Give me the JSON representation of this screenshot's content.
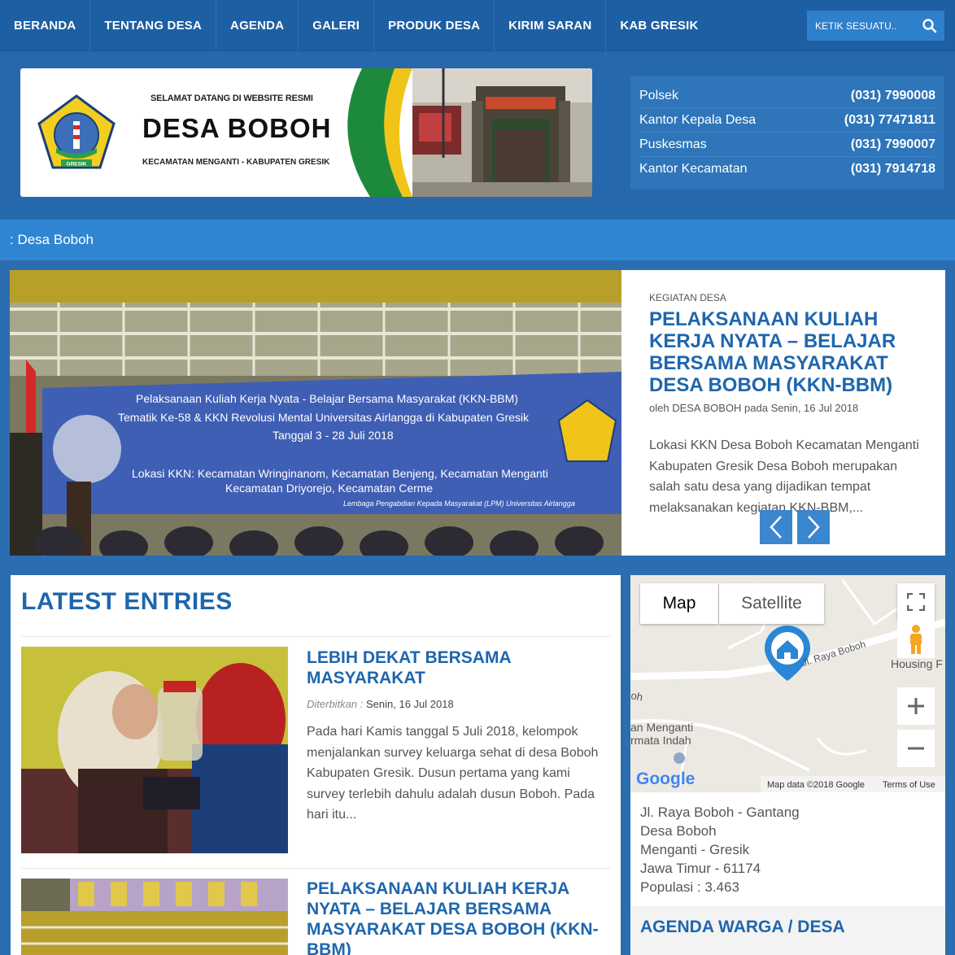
{
  "nav": {
    "items": [
      "BERANDA",
      "TENTANG DESA",
      "AGENDA",
      "GALERI",
      "PRODUK DESA",
      "KIRIM SARAN",
      "KAB GRESIK"
    ],
    "search_placeholder": "KETIK SESUATU.."
  },
  "banner": {
    "welcome": "SELAMAT DATANG DI WEBSITE RESMI",
    "name": "DESA BOBOH",
    "sub": "KECAMATAN MENGANTI - KABUPATEN GRESIK",
    "logo_text": "GRESIK"
  },
  "contacts": [
    {
      "label": "Polsek",
      "phone": "(031) 7990008"
    },
    {
      "label": "Kantor Kepala Desa",
      "phone": "(031) 77471811"
    },
    {
      "label": "Puskesmas",
      "phone": "(031) 7990007"
    },
    {
      "label": "Kantor Kecamatan",
      "phone": "(031) 7914718"
    }
  ],
  "ticker": ": Desa Boboh",
  "slider": {
    "category": "KEGIATAN DESA",
    "title": "PELAKSANAAN KULIAH KERJA NYATA – BELAJAR BERSAMA MASYARAKAT DESA BOBOH (KKN-BBM)",
    "meta": "oleh DESA BOBOH pada Senin, 16 Jul 2018",
    "excerpt": "Lokasi KKN Desa Boboh Kecamatan Menganti Kabupaten Gresik Desa Boboh merupakan salah satu desa yang dijadikan tempat melaksanakan kegiatan KKN-BBM,...",
    "banner_lines": [
      "Pelaksanaan Kuliah Kerja Nyata - Belajar Bersama Masyarakat (KKN-BBM)",
      "Tematik Ke-58 & KKN Revolusi Mental Universitas Airlangga di Kabupaten Gresik",
      "Tanggal 3 - 28 Juli 2018",
      "Lokasi KKN: Kecamatan Wringinanom, Kecamatan Benjeng, Kecamatan Menganti",
      "Kecamatan Driyorejo, Kecamatan Cerme",
      "Lembaga Pengabdian Kepada Masyarakat (LPM) Universitas Airlangga"
    ]
  },
  "latest": {
    "heading": "LATEST ENTRIES",
    "entries": [
      {
        "title": "LEBIH DEKAT BERSAMA MASYARAKAT",
        "meta_label": "Diterbitkan :",
        "meta_date": "Senin, 16 Jul 2018",
        "excerpt": "Pada hari Kamis tanggal 5 Juli 2018, kelompok menjalankan survey keluarga sehat di desa Boboh Kabupaten Gresik. Dusun pertama yang kami survey terlebih dahulu adalah dusun Boboh. Pada hari itu..."
      },
      {
        "title": "PELAKSANAAN KULIAH KERJA NYATA – BELAJAR BERSAMA MASYARAKAT DESA BOBOH (KKN-BBM)"
      }
    ]
  },
  "map": {
    "tab_map": "Map",
    "tab_satellite": "Satellite",
    "road_label": "Jl. Raya Boboh",
    "place1": "oh",
    "place2": "an Menganti",
    "place3": "rmata Indah",
    "place4": "Housing F",
    "google": "Google",
    "attribution": "Map data ©2018 Google",
    "terms": "Terms of Use"
  },
  "address": [
    "Jl. Raya Boboh - Gantang",
    "Desa Boboh",
    "Menganti - Gresik",
    "Jawa Timur - 61174",
    "Populasi : 3.463"
  ],
  "agenda_title": "AGENDA WARGA / DESA"
}
